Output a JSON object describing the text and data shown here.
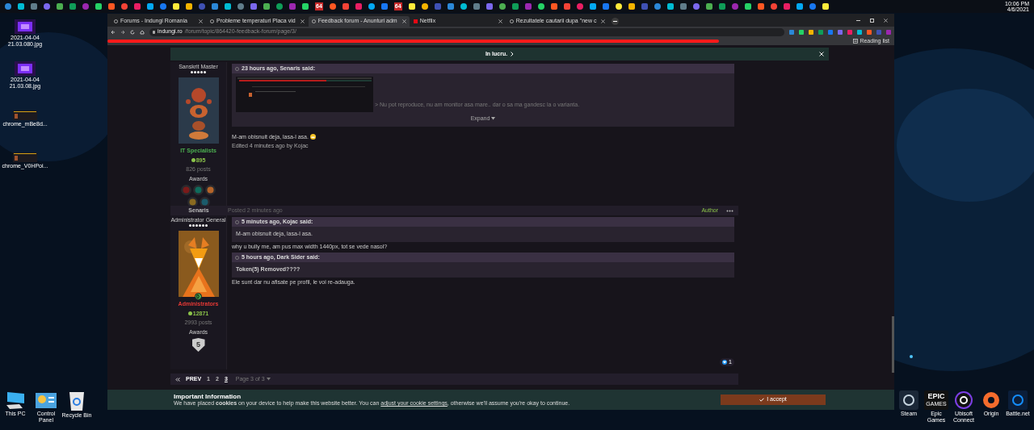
{
  "taskbar": {
    "badges": [
      "64",
      "64"
    ],
    "clock": {
      "time": "10:06 PM",
      "date": "4/6/2021"
    }
  },
  "desktop_icons_left": [
    {
      "label": "2021-04-04 21.03.080.jpg"
    },
    {
      "label": "2021-04-04 21.03.08.jpg"
    },
    {
      "label": "chrome_mBe8d..."
    },
    {
      "label": "chrome_V0HPoi..."
    }
  ],
  "desktop_icons_bottom": [
    {
      "label": "This PC"
    },
    {
      "label": "Control Panel"
    },
    {
      "label": "Recycle Bin"
    }
  ],
  "desktop_icons_right": [
    {
      "label": "Steam"
    },
    {
      "label": "Epic Games",
      "logo_text": [
        "EPIC",
        "GAMES"
      ]
    },
    {
      "label": "Ubisoft Connect"
    },
    {
      "label": "Origin"
    },
    {
      "label": "Battle.net"
    }
  ],
  "browser": {
    "tabs": [
      {
        "title": "Forums - Indungi Romania",
        "selected": false
      },
      {
        "title": "Probleme temperaturi Placa vid",
        "selected": false
      },
      {
        "title": "Feedback forum - Anunturi adm",
        "selected": true
      },
      {
        "title": "Netflix",
        "selected": false
      },
      {
        "title": "Rezultatele cautarii dupa \"new c",
        "selected": false
      }
    ],
    "url": {
      "domain": "indungi.ro",
      "path": "/forum/topic/864420-feedback-forum/page/3/"
    },
    "reading_list": "Reading list"
  },
  "banner": {
    "text": "In lucru."
  },
  "posts": [
    {
      "rank": "Sanskrit Master",
      "stars": 5,
      "group": {
        "name": "IT Specialists",
        "color": "#4caf50"
      },
      "reputation": "895",
      "posts": "826 posts",
      "awards_label": "Awards",
      "awards": [
        {
          "kind": "medal",
          "color": "#7a1a1a"
        },
        {
          "kind": "medal",
          "color": "#0f6b5c"
        },
        {
          "kind": "medal",
          "color": "#b5642a"
        },
        {
          "kind": "medal",
          "color": "#8a6a20"
        },
        {
          "kind": "medal",
          "color": "#1b5b6b"
        }
      ],
      "quotes": [
        {
          "header": "23 hours ago, Senaris said:",
          "has_image": true,
          "body": "> Nu pot reproduce, nu am monitor asa mare.. dar o sa ma gandesc la o varianta.",
          "bold": false,
          "expand": "Expand"
        }
      ],
      "body": [
        {
          "kind": "text",
          "text": "M-am obisnuit deja, lasa-l asa."
        },
        {
          "kind": "edited",
          "text": "Edited 4 minutes ago by Kojac"
        }
      ]
    },
    {
      "author": "Senaris",
      "posted": "Posted 2 minutes ago",
      "badge": "Author",
      "rank": "Administrator General",
      "stars": 6,
      "level": "0",
      "group": {
        "name": "Administrators",
        "color": "#e53935"
      },
      "reputation": "12871",
      "posts": "2993 posts",
      "awards_label": "Awards",
      "awards": [
        {
          "kind": "shield",
          "label": "5"
        }
      ],
      "quotes": [
        {
          "header": "5 minutes ago, Kojac said:",
          "has_image": false,
          "body": "M-am obisnuit deja, lasa-l asa.",
          "bold": false,
          "after": "why u bully me, am pus max width 1440px, tot se vede nasol?"
        },
        {
          "header": "5 hours ago, Dark Sider said:",
          "has_image": false,
          "body": "Token(5) Removed????",
          "bold": true,
          "after": "Ele sunt dar nu afisate pe profil, le voi re-adauga."
        }
      ],
      "reactions": "1"
    }
  ],
  "pagination": {
    "prev": "PREV",
    "pages": [
      {
        "label": "1",
        "selected": false
      },
      {
        "label": "2",
        "selected": false
      },
      {
        "label": "3",
        "selected": true
      }
    ],
    "page_of": "Page 3 of 3"
  },
  "cookie": {
    "title": "Important Information",
    "text": "We have placed **cookies** on your device to help make this website better. You can",
    "link": "adjust your cookie settings",
    "text_after": ", otherwise we'll assume you're okay to continue.",
    "accept": "I accept"
  }
}
